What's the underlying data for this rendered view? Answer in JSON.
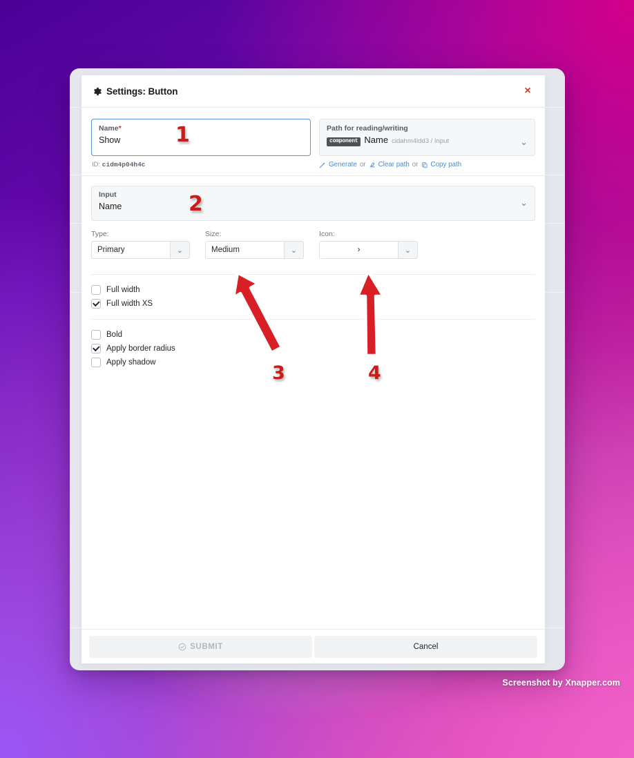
{
  "dialog": {
    "title": "Settings: Button",
    "gear_icon": "gear-icon",
    "close_icon": "close-icon",
    "close_label": "×"
  },
  "name_field": {
    "label": "Name",
    "required_marker": "*",
    "value": "Show",
    "id_prefix": "ID:",
    "id_value": "cidm4p04h4c"
  },
  "path_field": {
    "label": "Path for reading/writing",
    "chip": "component",
    "name": "Name",
    "sub": "cidahm4ldd3 / Input",
    "chevron": "⌄",
    "links": {
      "generate": "Generate",
      "or1": "or",
      "clear": "Clear path",
      "or2": "or",
      "copy": "Copy path"
    }
  },
  "input_select": {
    "label": "Input",
    "value": "Name",
    "chevron": "⌄"
  },
  "selects": [
    {
      "label": "Type:",
      "value": "Primary",
      "name": "type-select"
    },
    {
      "label": "Size:",
      "value": "Medium",
      "name": "size-select"
    },
    {
      "label": "Icon:",
      "value": "›",
      "name": "icon-select"
    }
  ],
  "checkbox_group_1": [
    {
      "label": "Full width",
      "checked": false
    },
    {
      "label": "Full width XS",
      "checked": true
    }
  ],
  "checkbox_group_2": [
    {
      "label": "Bold",
      "checked": false
    },
    {
      "label": "Apply border radius",
      "checked": true
    },
    {
      "label": "Apply shadow",
      "checked": false
    }
  ],
  "footer": {
    "submit_label": "SUBMIT",
    "cancel_label": "Cancel"
  },
  "annotations": {
    "n1": "1",
    "n2": "2",
    "n3": "3",
    "n4": "4",
    "arrow_color": "#d81f26"
  },
  "watermark": "Screenshot by Xnapper.com",
  "colors": {
    "accent_link": "#4a8ad4",
    "focus_border": "#5a93d8",
    "required": "#e03030",
    "close": "#e8302a",
    "annotation_red": "#cc1b1b"
  }
}
